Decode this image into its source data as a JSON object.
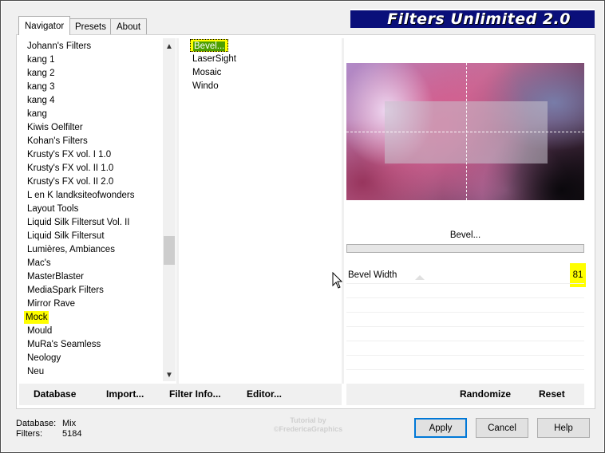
{
  "banner": {
    "title": "Filters Unlimited 2.0"
  },
  "tabs": [
    {
      "label": "Navigator",
      "active": true
    },
    {
      "label": "Presets",
      "active": false
    },
    {
      "label": "About",
      "active": false
    }
  ],
  "categories": [
    "Johann's Filters",
    "kang 1",
    "kang 2",
    "kang 3",
    "kang 4",
    "kang",
    "Kiwis Oelfilter",
    "Kohan's Filters",
    "Krusty's FX vol. I 1.0",
    "Krusty's FX vol. II 1.0",
    "Krusty's FX vol. II 2.0",
    "L en K landksiteofwonders",
    "Layout Tools",
    "Liquid Silk Filtersut Vol. II",
    "Liquid Silk Filtersut",
    "Lumières, Ambiances",
    "Mac's",
    "MasterBlaster",
    "MediaSpark Filters",
    "Mirror Rave",
    "Mock",
    "Mould",
    "MuRa's Seamless",
    "Neology",
    "Neu"
  ],
  "selected_category": "Mock",
  "filters": [
    "Bevel...",
    "LaserSight",
    "Mosaic",
    "Windo"
  ],
  "selected_filter": "Bevel...",
  "filter_button": {
    "label": "Bevel..."
  },
  "parameter": {
    "label": "Bevel Width",
    "value": "81"
  },
  "toolbar_left": {
    "database": "Database",
    "import": "Import...",
    "filter_info": "Filter Info...",
    "editor": "Editor..."
  },
  "toolbar_right": {
    "randomize": "Randomize",
    "reset": "Reset"
  },
  "status": {
    "database_label": "Database:",
    "database_value": "Mix",
    "filters_label": "Filters:",
    "filters_value": "5184"
  },
  "buttons": {
    "apply": "Apply",
    "cancel": "Cancel",
    "help": "Help"
  },
  "watermark": "Tutorial by ©FredericaGraphics",
  "colors": {
    "highlight": "#ffff00",
    "selection": "#4d9f00",
    "banner": "#0a0f7a",
    "focus": "#0078d7"
  }
}
